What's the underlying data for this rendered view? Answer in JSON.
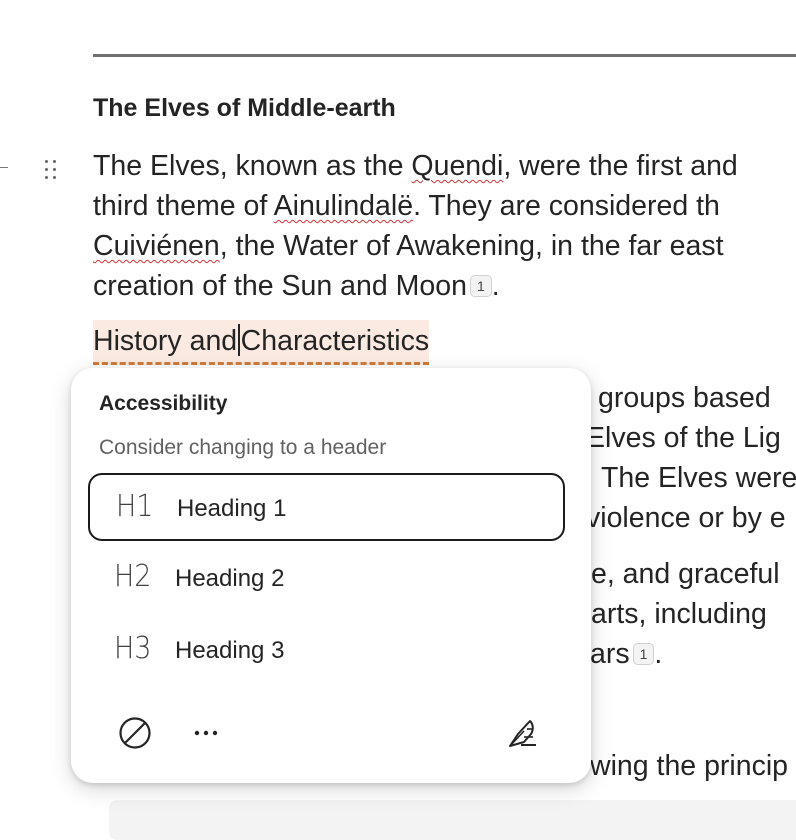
{
  "document": {
    "title": "The Elves of Middle-earth",
    "paragraph1": {
      "line1": {
        "a": "The Elves, known as the ",
        "b": "Quendi",
        "c": ", were the first and"
      },
      "line2": {
        "a": "third theme of ",
        "b": "Ainulindalë",
        "c": ". They are considered th"
      },
      "line3": {
        "a": "Cuiviénen",
        "b": ", the Water of Awakening, in the far east"
      },
      "line4": {
        "a": "creation of the Sun and Moon",
        "cite": "1",
        "end": "."
      }
    },
    "heading_candidate": {
      "before": "History and",
      "after": "Characteristics"
    },
    "obscured_fragments": {
      "f1": "groups based",
      "f2": "Elves of the Lig",
      "f3": "The Elves were",
      "f4": "violence or by e",
      "f5": "e, and graceful",
      "f6": "arts, including",
      "f7": "ars",
      "f7_cite": "1",
      "f7_end": ".",
      "f8": "wing the princip"
    }
  },
  "accessibility_popup": {
    "title": "Accessibility",
    "subtitle": "Consider changing to a header",
    "options": [
      {
        "icon": "H1",
        "label": "Heading 1",
        "selected": true
      },
      {
        "icon": "H2",
        "label": "Heading 2",
        "selected": false
      },
      {
        "icon": "H3",
        "label": "Heading 3",
        "selected": false
      }
    ],
    "footer_icons": [
      "ignore-icon",
      "more-options-icon",
      "feedback-quill-icon"
    ]
  },
  "colors": {
    "spellcheck": "#d13438",
    "heading_highlight": "#fbeae1",
    "heading_dash": "#cf7b3c"
  }
}
